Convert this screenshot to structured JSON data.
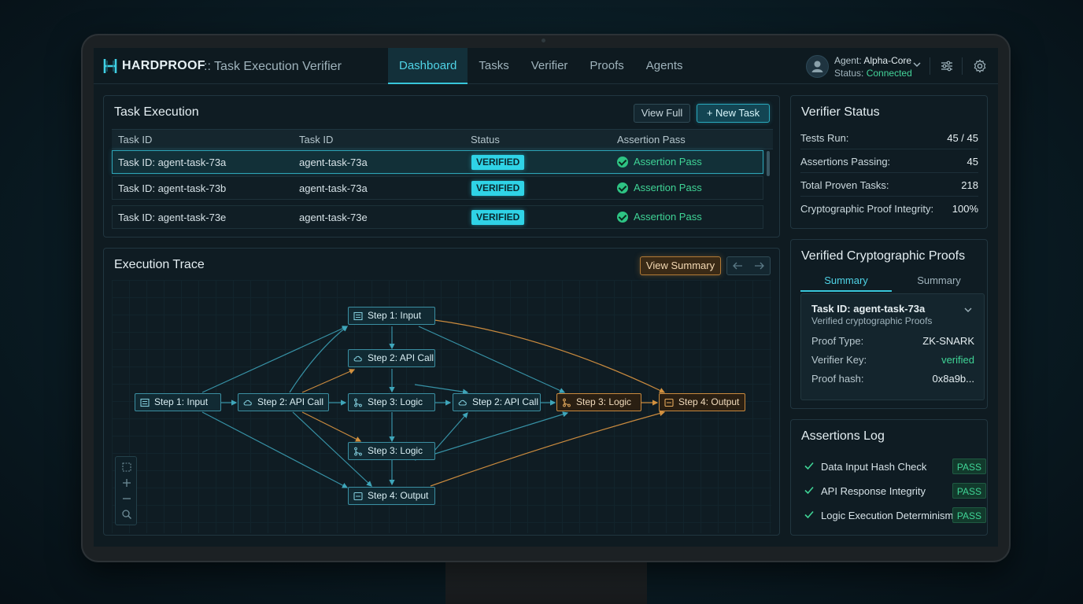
{
  "header": {
    "brand": "HARDPROOF",
    "subtitle": ":: Task Execution Verifier",
    "nav": [
      "Dashboard",
      "Tasks",
      "Verifier",
      "Proofs",
      "Agents"
    ],
    "active_nav": "Dashboard",
    "agent_label": "Agent:",
    "agent_name": "Alpha-Core",
    "status_label": "Status:",
    "status_value": "Connected"
  },
  "task_execution": {
    "title": "Task Execution",
    "view_full": "View Full",
    "new_task": "+ New Task",
    "columns": [
      "Task ID",
      "Task ID",
      "Status",
      "Assertion Pass"
    ],
    "rows": [
      {
        "id": "Task ID: agent-task-73a",
        "task": "agent-task-73a",
        "status": "VERIFIED",
        "pass": "Assertion Pass"
      },
      {
        "id": "Task ID: agent-task-73b",
        "task": "agent-task-73a",
        "status": "VERIFIED",
        "pass": "Assertion Pass"
      },
      {
        "id": "Task ID: agent-task-73e",
        "task": "agent-task-73e",
        "status": "VERIFIED",
        "pass": "Assertion Pass"
      }
    ]
  },
  "trace": {
    "title": "Execution Trace",
    "view_summary": "View Summary",
    "nodes": {
      "n1": "Step 1: Input",
      "n2": "Step 2: API Call",
      "n3": "Step 1: Input",
      "n4": "Step 2: API Call",
      "n5": "Step 3: Logic",
      "n6": "Step 2: API Call",
      "n7": "Step 3: Logic",
      "n8": "Step 4: Output",
      "n9": "Step 3: Logic",
      "n10": "Step 4: Output"
    }
  },
  "verifier_status": {
    "title": "Verifier Status",
    "rows": [
      {
        "k": "Tests Run:",
        "v": "45 / 45"
      },
      {
        "k": "Assertions Passing:",
        "v": "45"
      },
      {
        "k": "Total Proven Tasks:",
        "v": "218"
      },
      {
        "k": "Cryptographic Proof Integrity:",
        "v": "100%"
      }
    ]
  },
  "proofs": {
    "title": "Verified Cryptographic Proofs",
    "tabs": [
      "Summary",
      "Summary"
    ],
    "card_title": "Task ID: agent-task-73a",
    "card_sub": "Verified cryptographic Proofs",
    "rows": [
      {
        "k": "Proof Type:",
        "v": "ZK-SNARK"
      },
      {
        "k": "Verifier Key:",
        "v": "verified"
      },
      {
        "k": "Proof hash:",
        "v": "0x8a9b..."
      }
    ]
  },
  "assertions_log": {
    "title": "Assertions Log",
    "items": [
      {
        "label": "Data Input Hash Check",
        "status": "PASS"
      },
      {
        "label": "API Response Integrity",
        "status": "PASS"
      },
      {
        "label": "Logic Execution Determinism",
        "status": "PASS"
      }
    ]
  },
  "colors": {
    "accent": "#38c6da",
    "success": "#3fd496",
    "amber": "#c98a3e"
  }
}
